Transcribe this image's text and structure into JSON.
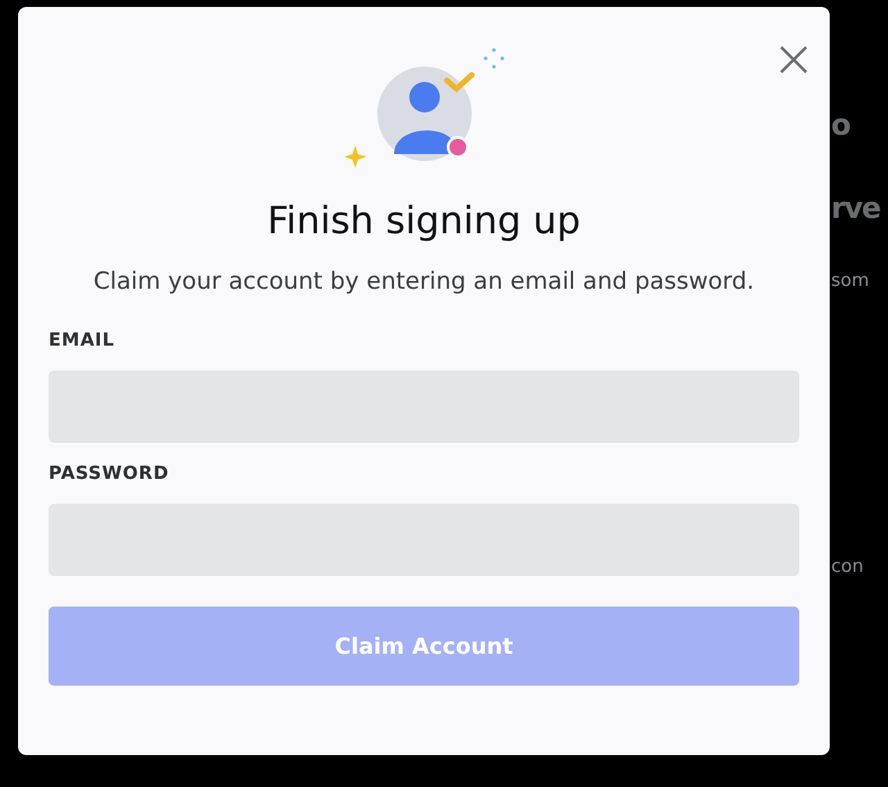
{
  "background": {
    "fragments": [
      {
        "text": "o",
        "kind": "heading"
      },
      {
        "text": "rve",
        "kind": "heading"
      },
      {
        "text": "som",
        "kind": "body"
      },
      {
        "text": "con",
        "kind": "body"
      }
    ]
  },
  "dialog": {
    "title": "Finish signing up",
    "subtitle": "Claim your account by entering an email and password.",
    "fields": [
      {
        "label": "EMAIL"
      },
      {
        "label": "PASSWORD"
      }
    ],
    "submit": {
      "label": "Claim Account",
      "disabled": true
    }
  }
}
